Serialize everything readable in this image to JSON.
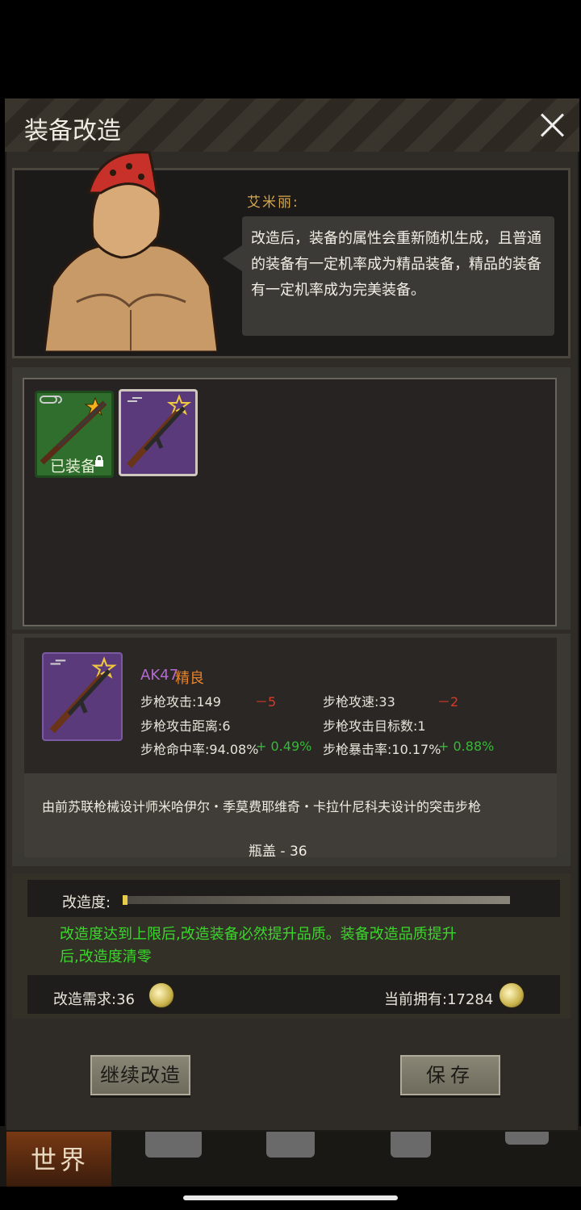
{
  "modal": {
    "title": "装备改造"
  },
  "npc": {
    "name": "艾米丽:",
    "speech": "改造后，装备的属性会重新随机生成，且普通的装备有一定机率成为精品装备，精品的装备有一定机率成为完美装备。"
  },
  "inventory": {
    "slots": [
      {
        "item": "rifle",
        "equipped_label": "已装备",
        "star": "filled"
      },
      {
        "item": "AK47",
        "star": "outline"
      }
    ]
  },
  "item": {
    "name": "AK47",
    "quality": "精良",
    "stats": [
      {
        "label": "步枪攻击:149",
        "delta": "－5",
        "delta_type": "neg"
      },
      {
        "label": "步枪攻速:33",
        "delta": "－2",
        "delta_type": "neg"
      },
      {
        "label": "步枪攻击距离:6",
        "delta": "",
        "delta_type": ""
      },
      {
        "label": "步枪攻击目标数:1",
        "delta": "",
        "delta_type": ""
      },
      {
        "label": "步枪命中率:94.08%",
        "delta": "+ 0.49%",
        "delta_type": "pos"
      },
      {
        "label": "步枪暴击率:10.17%",
        "delta": "+ 0.88%",
        "delta_type": "pos"
      }
    ],
    "description": "由前苏联枪械设计师米哈伊尔・季莫费耶维奇・卡拉什尼科夫设计的突击步枪",
    "cost": "瓶盖 - 36"
  },
  "modification": {
    "label": "改造度:",
    "progress": 0.01,
    "note": "改造度达到上限后,改造装备必然提升品质。装备改造品质提升后,改造度清零",
    "requirement": "改造需求:36",
    "owned": "当前拥有:17284"
  },
  "buttons": {
    "continue": "继续改造",
    "save": "保存"
  },
  "nav": {
    "world": "世界"
  },
  "colors": {
    "quality_purple": "#b46ad2",
    "quality_orange": "#e8832a",
    "positive": "#38b838",
    "negative": "#d83a2a",
    "note_green": "#3ad82a"
  }
}
